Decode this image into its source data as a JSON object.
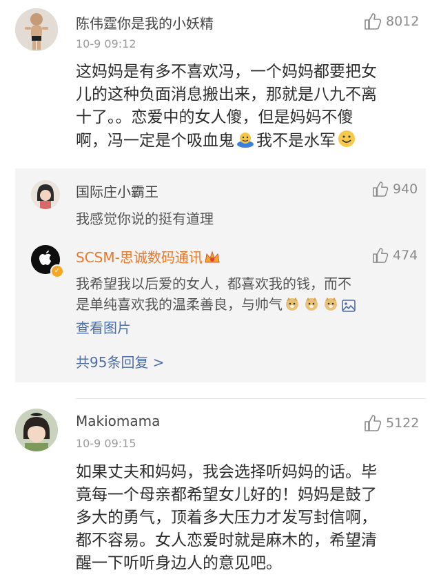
{
  "comment1": {
    "username": "陈伟霆你是我的小妖精",
    "timestamp": "10-9 09:12",
    "likes": "8012",
    "lines": [
      "这妈妈是有多不喜欢冯，一个妈妈都要把女",
      "儿的这种负面消息搬出来，那就是八九不离",
      "十了。。恋爱中的女人傻，但是妈妈不傻",
      "啊，冯一定是个吸血鬼"
    ],
    "line4_tail": "我不是水军"
  },
  "replies": {
    "reply1": {
      "username": "国际庄小霸王",
      "likes": "940",
      "text": "我感觉你说的挺有道理"
    },
    "reply2": {
      "username": "SCSM-思诚数码通讯",
      "likes": "474",
      "line1": "我希望我以后爱的女人，都喜欢我的钱，而不",
      "line2": "是单纯喜欢我的温柔善良，与帅气",
      "view_images": "查看图片"
    },
    "more_replies": "共95条回复 >"
  },
  "comment2": {
    "username": "Makiomama",
    "timestamp": "10-9 09:15",
    "likes": "5122",
    "lines": [
      "如果丈夫和妈妈，我会选择听妈妈的话。毕",
      "竟每一个母亲都希望女儿好的！妈妈是鼓了",
      "多大的勇气，顶着多大压力才发写封信啊，",
      "都不容易。女人恋爱时就是麻木的，希望清",
      "醒一下听听身边人的意见吧。"
    ]
  },
  "colors": {
    "link_blue": "#4d6ea8",
    "brand_orange": "#e8792b",
    "panel_bg": "#f4f4f4",
    "verified_badge": "#f5a623"
  },
  "icons": [
    "thumbs-up-icon",
    "vampire-emoji-icon",
    "smile-emoji-icon",
    "doge-emoji-icon",
    "image-icon",
    "verified-badge-icon",
    "vip-crown-icon"
  ]
}
